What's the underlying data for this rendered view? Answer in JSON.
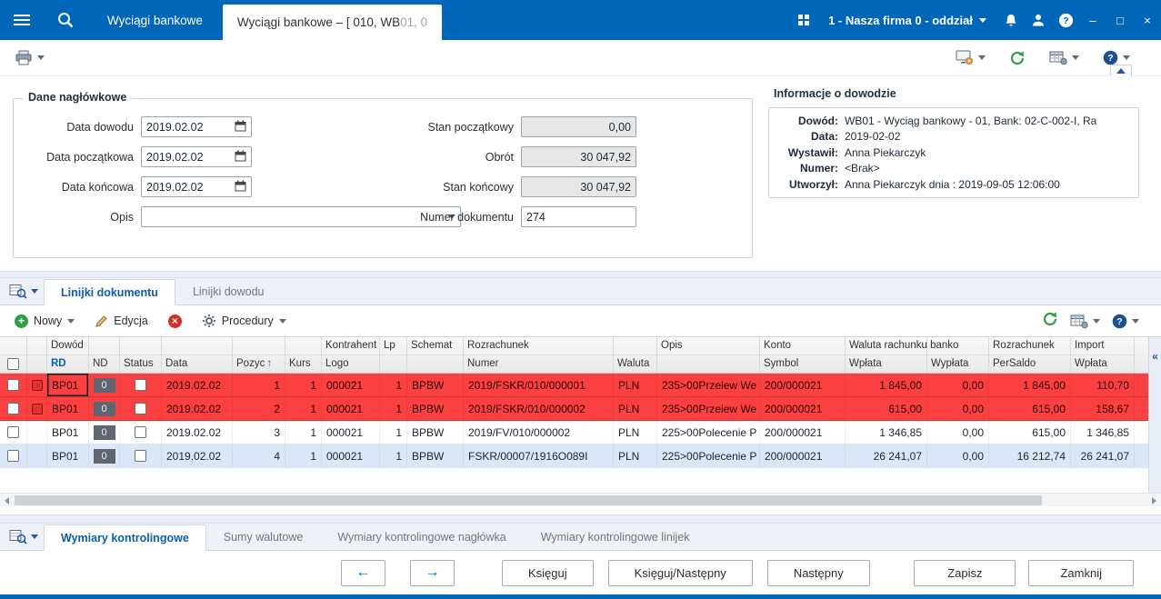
{
  "topbar": {
    "inactive_tab": "Wyciągi bankowe",
    "active_tab_main": "Wyciągi bankowe – [ 010, WB",
    "active_tab_dim": "01, 0",
    "company": "1 - Nasza firma 0 - oddział",
    "window": {
      "minimize": "–",
      "maximize": "□",
      "close": "×"
    }
  },
  "colors": {
    "accent": "#0067b8",
    "row_alert": "#fa4040",
    "row_alt": "#d9e7f8",
    "refresh_green": "#2f9e44"
  },
  "header_form": {
    "title": "Dane nagłówkowe",
    "fields_left": [
      {
        "label": "Data dowodu",
        "value": "2019.02.02",
        "type": "date"
      },
      {
        "label": "Data początkowa",
        "value": "2019.02.02",
        "type": "date"
      },
      {
        "label": "Data końcowa",
        "value": "2019.02.02",
        "type": "date"
      },
      {
        "label": "Opis",
        "value": "",
        "type": "combo"
      }
    ],
    "fields_right": [
      {
        "label": "Stan początkowy",
        "value": "0,00",
        "readonly": true
      },
      {
        "label": "Obrót",
        "value": "30 047,92",
        "readonly": true
      },
      {
        "label": "Stan końcowy",
        "value": "30 047,92",
        "readonly": true
      },
      {
        "label": "Numer dokumentu",
        "value": "274",
        "readonly": false
      }
    ]
  },
  "info_panel": {
    "title": "Informacje o dowodzie",
    "rows": [
      {
        "label": "Dowód:",
        "value": "WB01 - Wyciąg bankowy - 01, Bank: 02-C-002-I, Ra"
      },
      {
        "label": "Data:",
        "value": "2019-02-02"
      },
      {
        "label": "Wystawił:",
        "value": "Anna Piekarczyk"
      },
      {
        "label": "Numer:",
        "value": "<Brak>"
      },
      {
        "label": "Utworzył:",
        "value": "Anna Piekarczyk dnia : 2019-09-05 12:06:00"
      }
    ]
  },
  "mid_tabs": [
    {
      "label": "Linijki dokumentu",
      "name": "tab-linijki-dokumentu",
      "active": true
    },
    {
      "label": "Linijki dowodu",
      "name": "tab-linijki-dowodu",
      "active": false
    }
  ],
  "toolbar2": {
    "nowy": "Nowy",
    "edycja": "Edycja",
    "procedury": "Procedury"
  },
  "grid": {
    "sort_glyph": "↑",
    "collapse_glyph": "«",
    "columns": [
      {
        "key": "sel",
        "type": "sel",
        "w": 30,
        "top": "",
        "bottom": ""
      },
      {
        "key": "ind",
        "type": "ind",
        "w": 22,
        "top": "",
        "bottom": ""
      },
      {
        "key": "rd",
        "w": 46,
        "top": "Dowód",
        "bottom": "RD",
        "blue": true
      },
      {
        "key": "nd",
        "w": 34,
        "top": "",
        "bottom": "ND"
      },
      {
        "key": "status",
        "w": 46,
        "top": "",
        "bottom": "Status"
      },
      {
        "key": "data",
        "w": 78,
        "top": "",
        "bottom": "Data"
      },
      {
        "key": "pozyc",
        "w": 58,
        "top": "",
        "bottom": "Pozyc",
        "sort": true,
        "align": "right"
      },
      {
        "key": "kurs",
        "w": 40,
        "top": "",
        "bottom": "Kurs",
        "align": "right"
      },
      {
        "key": "logo",
        "w": 64,
        "top": "Kontrahent",
        "bottom": "Logo"
      },
      {
        "key": "lp",
        "w": 30,
        "top": "Lp",
        "bottom": "",
        "align": "right"
      },
      {
        "key": "schemat",
        "w": 62,
        "top": "Schemat",
        "bottom": ""
      },
      {
        "key": "numer",
        "w": 165,
        "top": "Rozrachunek",
        "bottom": "Numer"
      },
      {
        "key": "waluta",
        "w": 48,
        "top": "",
        "bottom": "Waluta"
      },
      {
        "key": "opis",
        "w": 113,
        "top": "Opis",
        "bottom": ""
      },
      {
        "key": "symbol",
        "w": 94,
        "top": "Konto",
        "bottom": "Symbol"
      },
      {
        "key": "wplata",
        "w": 90,
        "top": "Waluta rachunku banko",
        "bottom": "Wpłata",
        "align": "right"
      },
      {
        "key": "wyplata",
        "w": 68,
        "top": "",
        "bottom": "Wypłata",
        "align": "right"
      },
      {
        "key": "persaldo",
        "w": 90,
        "top": "Rozrachunek",
        "bottom": "PerSaldo",
        "align": "right"
      },
      {
        "key": "import_wplata",
        "w": 70,
        "top": "Import",
        "bottom": "Wpłata",
        "align": "right"
      }
    ],
    "rows": [
      {
        "style": "red",
        "indicator": true,
        "focus": "rd",
        "cells": {
          "rd": "BP01",
          "nd": "0",
          "data": "2019.02.02",
          "pozyc": "1",
          "kurs": "1",
          "logo": "000021",
          "lp": "1",
          "schemat": "BPBW",
          "numer": "2019/FSKR/010/000001",
          "waluta": "PLN",
          "opis": "235>00Przelew We",
          "symbol": "200/000021",
          "wplata": "1 845,00",
          "wyplata": "0,00",
          "persaldo": "1 845,00",
          "import_wplata": "110,70"
        }
      },
      {
        "style": "red",
        "indicator": true,
        "cells": {
          "rd": "BP01",
          "nd": "0",
          "data": "2019.02.02",
          "pozyc": "2",
          "kurs": "1",
          "logo": "000021",
          "lp": "1",
          "schemat": "BPBW",
          "numer": "2019/FSKR/010/000002",
          "waluta": "PLN",
          "opis": "235>00Przelew We",
          "symbol": "200/000021",
          "wplata": "615,00",
          "wyplata": "0,00",
          "persaldo": "615,00",
          "import_wplata": "158,67"
        }
      },
      {
        "style": "white",
        "indicator": false,
        "cells": {
          "rd": "BP01",
          "nd": "0",
          "data": "2019.02.02",
          "pozyc": "3",
          "kurs": "1",
          "logo": "000021",
          "lp": "1",
          "schemat": "BPBW",
          "numer": "2019/FV/010/000002",
          "waluta": "PLN",
          "opis": "225>00Polecenie P",
          "symbol": "200/000021",
          "wplata": "1 346,85",
          "wyplata": "0,00",
          "persaldo": "615,00",
          "import_wplata": "1 346,85"
        }
      },
      {
        "style": "blue",
        "indicator": false,
        "cells": {
          "rd": "BP01",
          "nd": "0",
          "data": "2019.02.02",
          "pozyc": "4",
          "kurs": "1",
          "logo": "000021",
          "lp": "1",
          "schemat": "BPBW",
          "numer": "FSKR/00007/1916O089I",
          "waluta": "PLN",
          "opis": "225>00Polecenie P",
          "symbol": "200/000021",
          "wplata": "26 241,07",
          "wyplata": "0,00",
          "persaldo": "16 212,74",
          "import_wplata": "26 241,07"
        }
      }
    ]
  },
  "bottom_tabs": [
    {
      "label": "Wymiary kontrolingowe",
      "name": "tab-wymiary-kontrolingowe",
      "active": true
    },
    {
      "label": "Sumy walutowe",
      "name": "tab-sumy-walutowe",
      "active": false
    },
    {
      "label": "Wymiary kontrolingowe nagłówka",
      "name": "tab-wymiary-naglowka",
      "active": false
    },
    {
      "label": "Wymiary kontrolingowe linijek",
      "name": "tab-wymiary-linijek",
      "active": false
    }
  ],
  "footer": {
    "prev_glyph": "←",
    "next_glyph": "→",
    "buttons": [
      {
        "label": "Księguj",
        "name": "ksieguj-button"
      },
      {
        "label": "Księguj/Następny",
        "name": "ksieguj-nastepny-button"
      },
      {
        "label": "Następny",
        "name": "nastepny-button"
      }
    ],
    "right_buttons": [
      {
        "label": "Zapisz",
        "name": "zapisz-button"
      },
      {
        "label": "Zamknij",
        "name": "zamknij-button"
      }
    ]
  }
}
